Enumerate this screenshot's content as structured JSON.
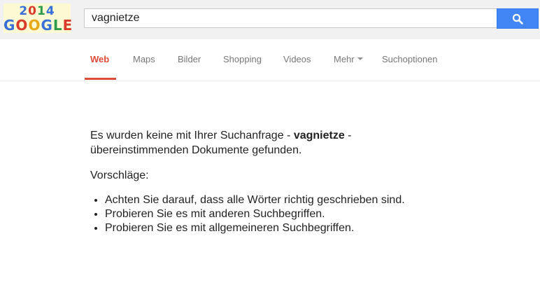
{
  "logo": {
    "year_digits": [
      "2",
      "0",
      "1",
      "4"
    ],
    "word_letters": [
      "G",
      "O",
      "O",
      "G",
      "L",
      "E"
    ]
  },
  "search": {
    "query": "vagnietze",
    "button_icon": "search-icon"
  },
  "nav": {
    "tabs": [
      {
        "label": "Web",
        "active": true
      },
      {
        "label": "Maps",
        "active": false
      },
      {
        "label": "Bilder",
        "active": false
      },
      {
        "label": "Shopping",
        "active": false
      },
      {
        "label": "Videos",
        "active": false
      },
      {
        "label": "Mehr",
        "active": false,
        "icon": "dropdown-arrow-icon"
      },
      {
        "label": "Suchoptionen",
        "active": false
      }
    ]
  },
  "colors": {
    "active_tab": "#dd4b39",
    "search_button": "#4285f4",
    "header_bg": "#f1f1f1"
  },
  "results": {
    "msg_before": "Es wurden keine mit Ihrer Suchanfrage - ",
    "msg_query": "vagnietze",
    "msg_after": " - übereinstimmenden Dokumente gefunden.",
    "suggestions_title": "Vorschläge:",
    "suggestions": [
      "Achten Sie darauf, dass alle Wörter richtig geschrieben sind.",
      "Probieren Sie es mit anderen Suchbegriffen.",
      "Probieren Sie es mit allgemeineren Suchbegriffen."
    ]
  }
}
